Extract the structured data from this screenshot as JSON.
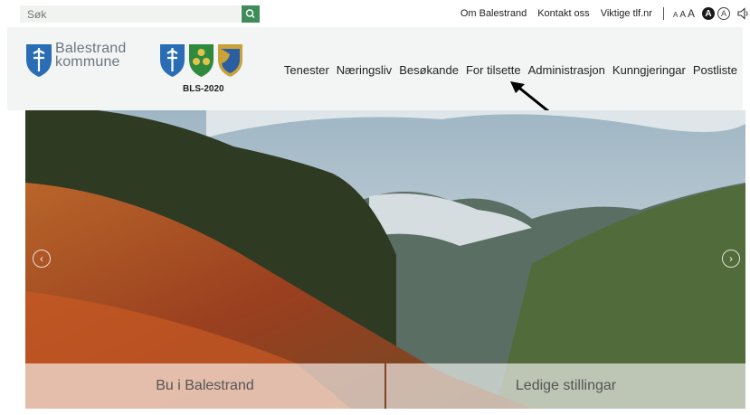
{
  "search": {
    "placeholder": "Søk",
    "icon": "search-icon"
  },
  "utility": {
    "links": [
      "Om Balestrand",
      "Kontakt oss",
      "Viktige tlf.nr"
    ],
    "font_sizes": [
      "A",
      "A",
      "A"
    ],
    "contrast_dark": "A",
    "contrast_light": "A",
    "speaker_icon": "speaker-icon"
  },
  "header": {
    "logo_line1": "Balestrand",
    "logo_line2": "kommune",
    "bls_label": "BLS-2020",
    "colors": {
      "shield_blue": "#2a6db5",
      "shield_green": "#2f8a3e",
      "shield_gold": "#c9a33a"
    }
  },
  "nav": [
    "Tenester",
    "Næringsliv",
    "Besøkande",
    "For tilsette",
    "Administrasjon",
    "Kunngjeringar",
    "Postliste"
  ],
  "hero": {
    "tiles": [
      "Bu i Balestrand",
      "Ledige stillingar"
    ],
    "prev_icon": "chevron-left-icon",
    "next_icon": "chevron-right-icon"
  },
  "annotation": {
    "icon": "arrow-icon",
    "color": "#000000"
  }
}
